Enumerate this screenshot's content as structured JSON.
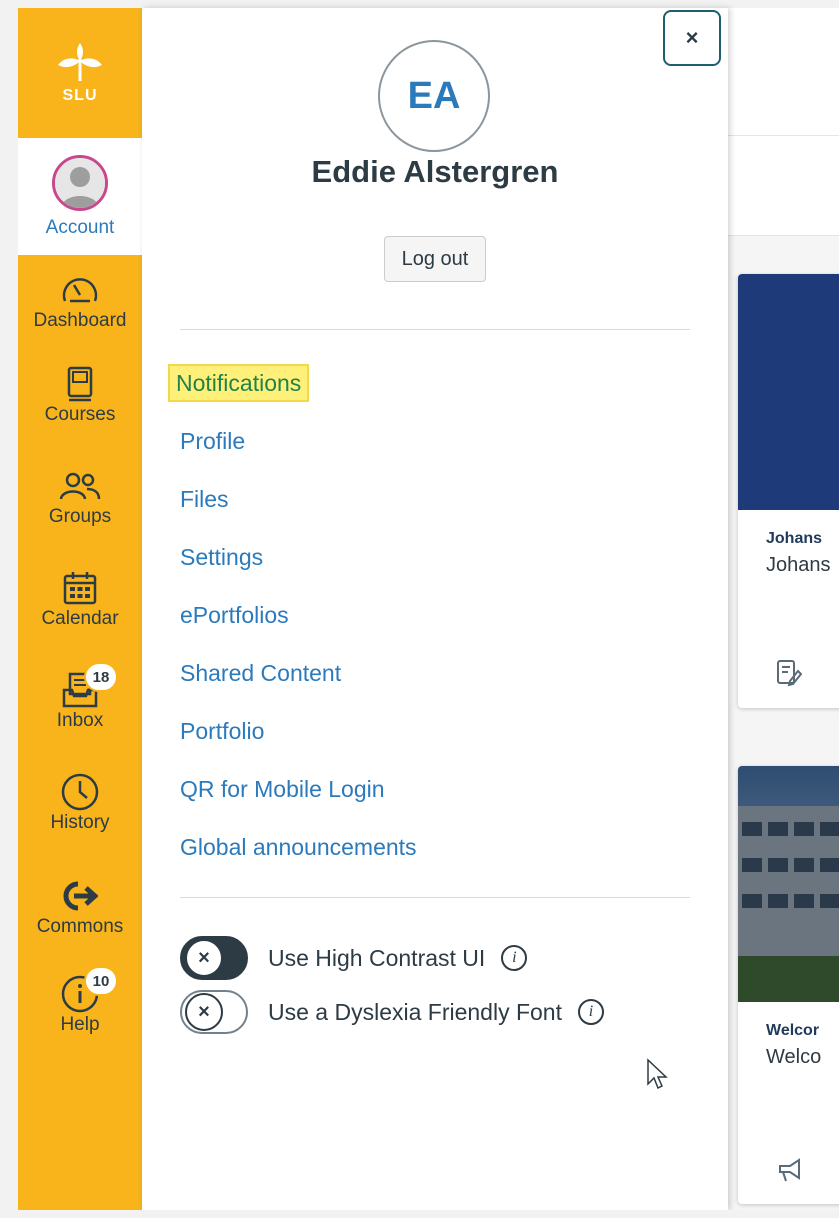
{
  "nav": {
    "logo_text": "SLU",
    "items": [
      {
        "label": "Account"
      },
      {
        "label": "Dashboard"
      },
      {
        "label": "Courses"
      },
      {
        "label": "Groups"
      },
      {
        "label": "Calendar"
      },
      {
        "label": "Inbox",
        "badge": "18"
      },
      {
        "label": "History"
      },
      {
        "label": "Commons"
      },
      {
        "label": "Help",
        "badge": "10"
      }
    ]
  },
  "tray": {
    "close_label": "×",
    "initials": "EA",
    "user_name": "Eddie Alstergren",
    "logout_label": "Log out",
    "links": [
      {
        "label": "Notifications"
      },
      {
        "label": "Profile"
      },
      {
        "label": "Files"
      },
      {
        "label": "Settings"
      },
      {
        "label": "ePortfolios"
      },
      {
        "label": "Shared Content"
      },
      {
        "label": "Portfolio"
      },
      {
        "label": "QR for Mobile Login"
      },
      {
        "label": "Global announcements"
      }
    ],
    "toggles": [
      {
        "label": "Use High Contrast UI",
        "knob": "×"
      },
      {
        "label": "Use a Dyslexia Friendly Font",
        "knob": "×"
      }
    ],
    "info_glyph": "i"
  },
  "background": {
    "cards": [
      {
        "title": "Johans",
        "subtitle": "Johans"
      },
      {
        "title": "Welcor",
        "subtitle": "Welco"
      }
    ]
  },
  "colors": {
    "nav_bg": "#f8b41a",
    "link": "#2b7abc",
    "text": "#2d3b45",
    "highlight": "#fff07a"
  }
}
